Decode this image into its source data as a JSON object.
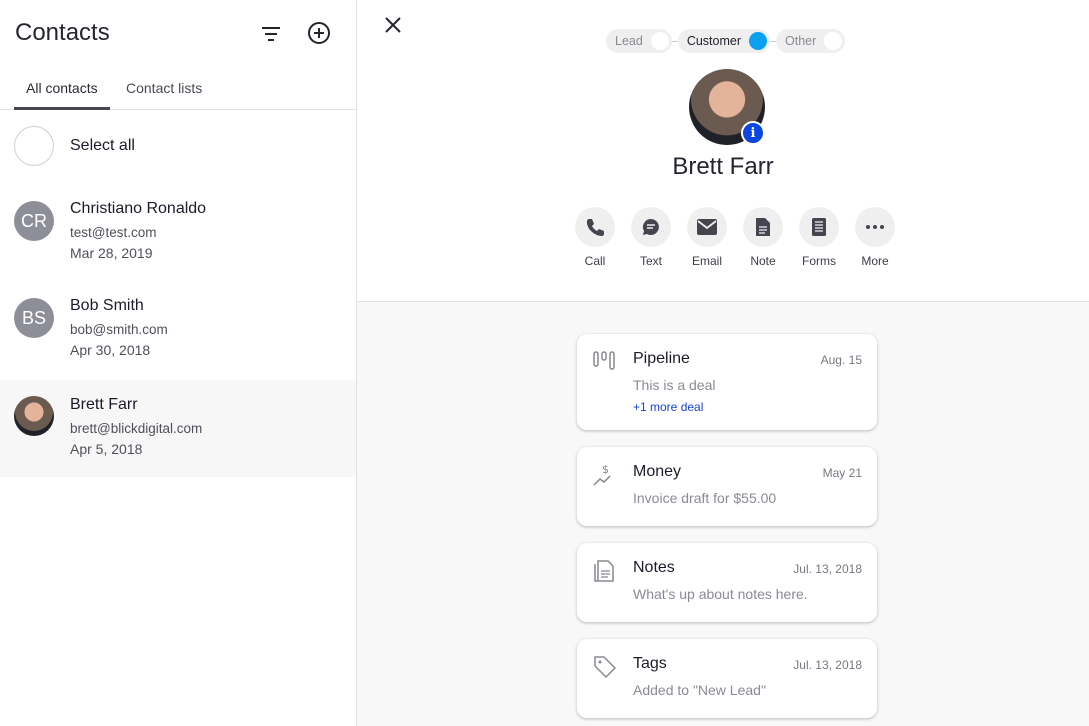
{
  "sidebar": {
    "title": "Contacts",
    "tabs": [
      {
        "label": "All contacts",
        "active": true
      },
      {
        "label": "Contact lists",
        "active": false
      }
    ],
    "select_all": "Select all",
    "contacts": [
      {
        "initials": "CR",
        "name": "Christiano Ronaldo",
        "email": "test@test.com",
        "date": "Mar 28, 2019"
      },
      {
        "initials": "BS",
        "name": "Bob Smith",
        "email": "bob@smith.com",
        "date": "Apr 30, 2018"
      },
      {
        "initials": "",
        "name": "Brett Farr",
        "email": "brett@blickdigital.com",
        "date": "Apr 5, 2018",
        "selected": true
      }
    ]
  },
  "detail": {
    "stages": [
      {
        "label": "Lead",
        "active": false
      },
      {
        "label": "Customer",
        "active": true
      },
      {
        "label": "Other",
        "active": false
      }
    ],
    "name": "Brett Farr",
    "actions": [
      {
        "label": "Call",
        "icon": "phone-icon"
      },
      {
        "label": "Text",
        "icon": "chat-icon"
      },
      {
        "label": "Email",
        "icon": "mail-icon"
      },
      {
        "label": "Note",
        "icon": "note-icon"
      },
      {
        "label": "Forms",
        "icon": "forms-icon"
      },
      {
        "label": "More",
        "icon": "more-icon"
      }
    ],
    "cards": [
      {
        "title": "Pipeline",
        "date": "Aug. 15",
        "subtitle": "This is a deal",
        "link": "+1 more deal",
        "icon": "pipeline-icon"
      },
      {
        "title": "Money",
        "date": "May 21",
        "subtitle": "Invoice draft for $55.00",
        "icon": "money-icon"
      },
      {
        "title": "Notes",
        "date": "Jul. 13, 2018",
        "subtitle": "What's up about notes here.",
        "icon": "notes-icon"
      },
      {
        "title": "Tags",
        "date": "Jul. 13, 2018",
        "subtitle": "Added to \"New Lead\"",
        "icon": "tag-icon"
      }
    ]
  },
  "colors": {
    "accent": "#0aa1f0",
    "link": "#1742d8",
    "info_badge": "#0b46e0"
  }
}
